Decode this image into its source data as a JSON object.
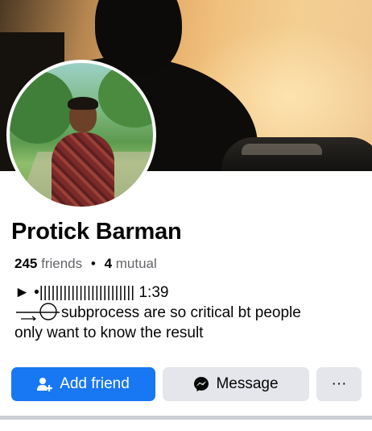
{
  "profile": {
    "name": "Protick Barman",
    "friends_count": "245",
    "friends_label": "friends",
    "separator": "•",
    "mutual_count": "4",
    "mutual_label": "mutual"
  },
  "bio": {
    "line1": "► •|||||||||||||||||||||||| 1:39",
    "line2": "subprocess are so critical bt people",
    "line3": "only want to know the result"
  },
  "actions": {
    "add_friend": "Add friend",
    "message": "Message",
    "more": "···"
  },
  "colors": {
    "primary": "#1877f2",
    "secondary_button": "#e4e6eb",
    "text_primary": "#050505",
    "text_secondary": "#65676b"
  },
  "icons": {
    "add_friend": "add-person-icon",
    "message": "messenger-icon",
    "more": "more-dots-icon"
  }
}
